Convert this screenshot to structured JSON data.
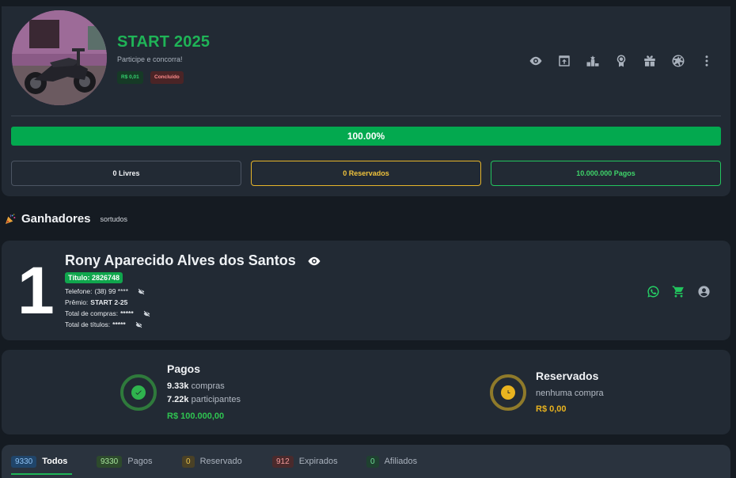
{
  "campaign": {
    "title": "START 2025",
    "subtitle": "Participe e concorra!",
    "price_badge": "R$ 0,01",
    "status_badge": "Concluído",
    "progress_text": "100.00%",
    "progress_value": 1.0,
    "free_label": "0 Livres",
    "reserved_label": "0 Reservados",
    "paid_label": "10.000.000 Pagos",
    "toolbar_icons": [
      "eye-icon",
      "upload-icon",
      "podium-icon",
      "medal-icon",
      "gift-icon",
      "aperture-icon",
      "more-vertical-icon"
    ]
  },
  "winners": {
    "title": "Ganhadores",
    "subtitle": "sortudos"
  },
  "winner": {
    "rank": "1",
    "name": "Rony Aparecido Alves dos Santos",
    "ticket": "Título: 2826748",
    "phone_key": "Telefone:",
    "phone_value": "(38) 99 ****",
    "prize_key": "Prêmio:",
    "prize_value": "START 2-25",
    "purchases_key": "Total de compras:",
    "purchases_value": "*****",
    "titles_key": "Total de títulos:",
    "titles_value": "*****",
    "colors": {
      "whatsapp": "#25d366",
      "cart": "#22c55e",
      "user": "#aab2bd"
    }
  },
  "summary": {
    "paid": {
      "title": "Pagos",
      "purchases_num": "9.33k",
      "purchases_word": "compras",
      "participants_num": "7.22k",
      "participants_word": "participantes",
      "amount": "R$ 100.000,00"
    },
    "reserved": {
      "title": "Reservados",
      "text": "nenhuma compra",
      "amount": "R$ 0,00"
    }
  },
  "tabs": [
    {
      "count": "9330",
      "label": "Todos"
    },
    {
      "count": "9330",
      "label": "Pagos"
    },
    {
      "count": "0",
      "label": "Reservado"
    },
    {
      "count": "912",
      "label": "Expirados"
    },
    {
      "count": "0",
      "label": "Afiliados"
    }
  ]
}
